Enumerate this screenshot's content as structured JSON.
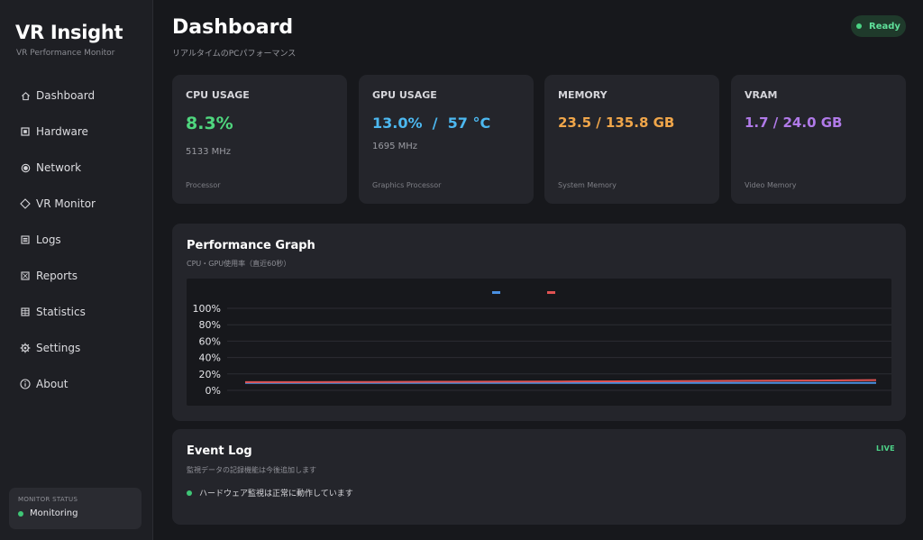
{
  "app": {
    "title": "VR Insight",
    "subtitle": "VR Performance Monitor"
  },
  "sidebar": {
    "items": [
      {
        "label": "Dashboard",
        "icon": "home-icon"
      },
      {
        "label": "Hardware",
        "icon": "chip-icon"
      },
      {
        "label": "Network",
        "icon": "network-icon"
      },
      {
        "label": "VR Monitor",
        "icon": "diamond-icon"
      },
      {
        "label": "Logs",
        "icon": "list-icon"
      },
      {
        "label": "Reports",
        "icon": "report-icon"
      },
      {
        "label": "Statistics",
        "icon": "table-icon"
      },
      {
        "label": "Settings",
        "icon": "gear-icon"
      },
      {
        "label": "About",
        "icon": "info-icon"
      }
    ],
    "monitor_status": {
      "label": "MONITOR STATUS",
      "value": "Monitoring"
    }
  },
  "header": {
    "title": "Dashboard",
    "subtitle": "リアルタイムのPCパフォーマンス",
    "status_badge": "Ready"
  },
  "stats": {
    "cpu": {
      "title": "CPU USAGE",
      "value": "8.3%",
      "sub": "5133 MHz",
      "footer": "Processor",
      "color": "#4fd67e"
    },
    "gpu": {
      "title": "GPU USAGE",
      "value": "13.0%  /  57 °C",
      "sub": "1695 MHz",
      "footer": "Graphics Processor",
      "color": "#4cb8f0"
    },
    "memory": {
      "title": "MEMORY",
      "value": "23.5 / 135.8 GB",
      "footer": "System Memory",
      "color": "#f0a64a"
    },
    "vram": {
      "title": "VRAM",
      "value": "1.7 / 24.0 GB",
      "footer": "Video Memory",
      "color": "#b07ae8"
    }
  },
  "graph": {
    "title": "Performance Graph",
    "subtitle": "CPU・GPU使用率（直近60秒）"
  },
  "chart_data": {
    "type": "line",
    "ylim": [
      0,
      100
    ],
    "ytick_labels": [
      "0%",
      "20%",
      "40%",
      "60%",
      "80%",
      "100%"
    ],
    "grid": true,
    "legend": "top-center",
    "series": [
      {
        "color": "#4a90e2",
        "values": [
          9,
          9,
          9,
          9,
          9,
          9,
          9,
          9,
          9,
          9,
          9
        ]
      },
      {
        "color": "#e05252",
        "values": [
          10,
          10,
          10.2,
          10.4,
          10.6,
          10.8,
          11,
          11.2,
          11.6,
          12,
          12.5
        ]
      }
    ]
  },
  "event_log": {
    "title": "Event Log",
    "subtitle": "監視データの記録機能は今後追加します",
    "live_label": "LIVE",
    "items": [
      "ハードウェア監視は正常に動作しています"
    ]
  },
  "colors": {
    "status_green": "#3fc676"
  }
}
